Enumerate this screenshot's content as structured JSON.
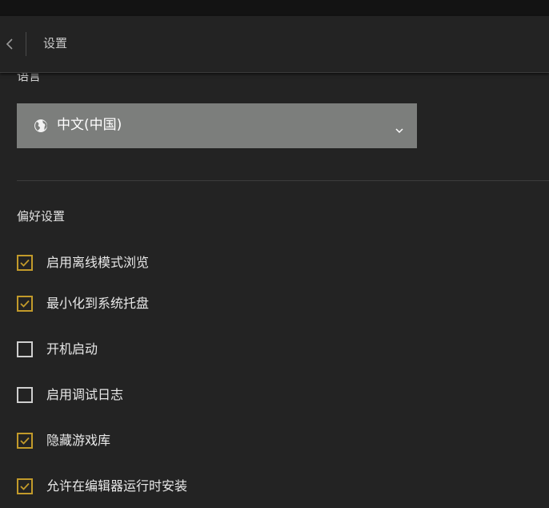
{
  "header": {
    "back_icon": "chevron-left-icon",
    "title": "设置"
  },
  "language": {
    "label": "语言",
    "globe_icon": "globe-icon",
    "selected": "中文(中国)",
    "chevron_icon": "chevron-down-icon"
  },
  "preferences": {
    "label": "偏好设置",
    "items": [
      {
        "label": "启用离线模式浏览",
        "checked": true
      },
      {
        "label": "最小化到系统托盘",
        "checked": true
      },
      {
        "label": "开机启动",
        "checked": false
      },
      {
        "label": "启用调试日志",
        "checked": false
      },
      {
        "label": "隐藏游戏库",
        "checked": true
      },
      {
        "label": "允许在编辑器运行时安装",
        "checked": true
      }
    ]
  },
  "colors": {
    "accent_check": "#c29a2a",
    "background": "#232323",
    "select_bg": "#7c7e7c"
  }
}
